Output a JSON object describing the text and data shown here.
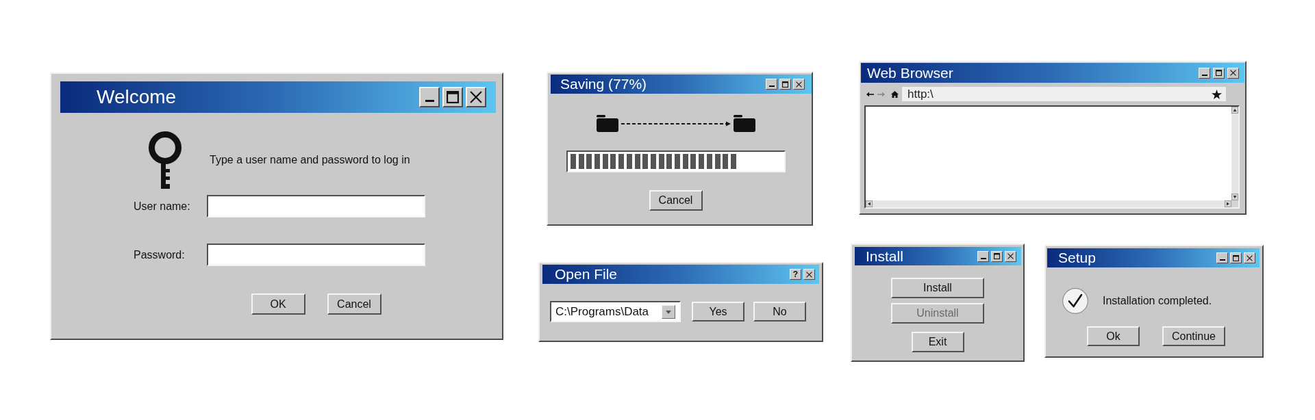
{
  "windows": [
    {
      "kind": "login",
      "title": "Welcome",
      "title_buttons": [
        {
          "kind": "minimize"
        },
        {
          "kind": "maximize"
        },
        {
          "kind": "close"
        }
      ],
      "message": "Type a user name and password to log in",
      "fields": [
        {
          "label": "User name:"
        },
        {
          "label": "Password:"
        }
      ],
      "buttons": [
        "OK",
        "Cancel"
      ]
    },
    {
      "kind": "progress",
      "title": "Saving (77%)",
      "title_buttons": [
        {
          "kind": "minimize"
        },
        {
          "kind": "maximize"
        },
        {
          "kind": "close"
        }
      ],
      "progress": {
        "level": 0.8
      },
      "buttons": [
        "Cancel"
      ]
    },
    {
      "kind": "browser",
      "title": "Web Browser",
      "title_buttons": [
        {
          "kind": "minimize"
        },
        {
          "kind": "maximize"
        },
        {
          "kind": "close"
        }
      ],
      "nav_buttons": [
        {
          "kind": "back",
          "disabled": false
        },
        {
          "kind": "forward",
          "disabled": true
        },
        {
          "kind": "home",
          "disabled": false
        }
      ],
      "address": "http:\\"
    },
    {
      "kind": "file",
      "title": "Open File",
      "title_buttons": [
        {
          "kind": "help",
          "label": "?"
        },
        {
          "kind": "close"
        }
      ],
      "dropdown": {
        "value": "C:\\Programs\\Data"
      },
      "buttons": [
        "Yes",
        "No"
      ]
    },
    {
      "kind": "install",
      "title": "Install",
      "title_buttons": [
        {
          "kind": "minimize"
        },
        {
          "kind": "maximize"
        },
        {
          "kind": "close"
        }
      ],
      "buttons": [
        {
          "label": "Install",
          "disabled": false
        },
        {
          "label": "Uninstall",
          "disabled": true
        },
        {
          "label": "Exit",
          "disabled": false
        }
      ]
    },
    {
      "kind": "message",
      "title": "Setup",
      "title_buttons": [
        {
          "kind": "minimize"
        },
        {
          "kind": "maximize"
        },
        {
          "kind": "close"
        }
      ],
      "message": "Installation completed.",
      "buttons": [
        "Ok",
        "Continue"
      ]
    }
  ]
}
